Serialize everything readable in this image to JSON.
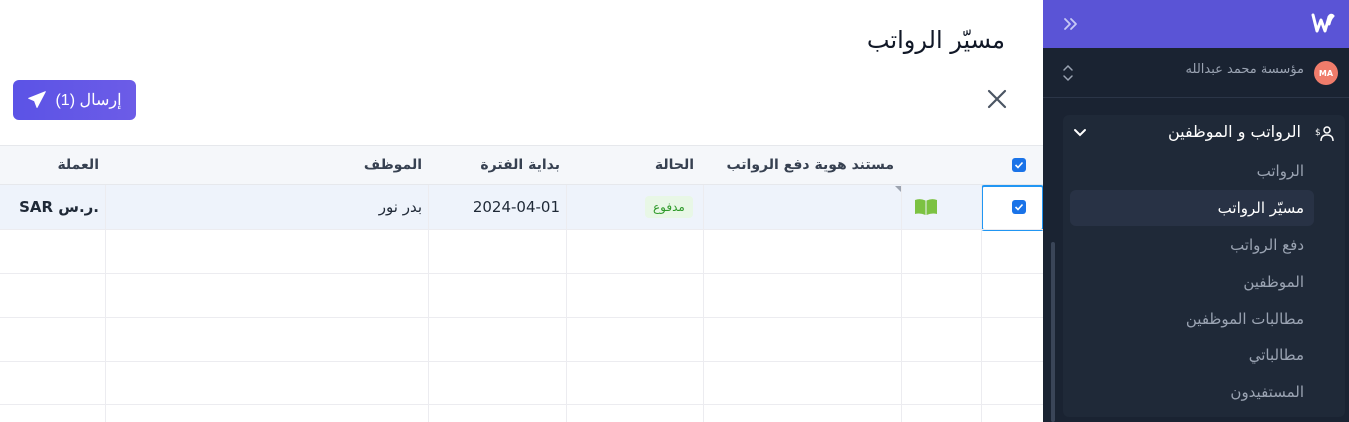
{
  "page": {
    "title": "مسيّر الرواتب",
    "send_button_label": "إرسال (1)"
  },
  "table": {
    "columns": [
      "مستند هوية دفع الرواتب",
      "الحالة",
      "بداية الفترة",
      "الموظف",
      "العملة"
    ],
    "rows": [
      {
        "selected": true,
        "document_id": "",
        "status": "مدفوع",
        "period_start": "2024-04-01",
        "employee": "بدر نور",
        "currency": "SAR ر.س."
      }
    ]
  },
  "sidebar": {
    "organization": {
      "avatar_initials": "MA",
      "name": "مؤسسة محمد عبدالله"
    },
    "group": {
      "label": "الرواتب و الموظفين",
      "items": [
        {
          "label": "الرواتب",
          "active": false
        },
        {
          "label": "مسيّر الرواتب",
          "active": true
        },
        {
          "label": "دفع الرواتب",
          "active": false
        },
        {
          "label": "الموظفين",
          "active": false
        },
        {
          "label": "مطالبات الموظفين",
          "active": false
        },
        {
          "label": "مطالباتي",
          "active": false
        },
        {
          "label": "المستفيدون",
          "active": false
        }
      ]
    }
  },
  "colors": {
    "accent": "#5a54d6",
    "primary_button": "#5b53e6",
    "checkbox": "#1a73e8",
    "status_paid_text": "#2e9a2a",
    "status_paid_bg": "#e8f7e6",
    "sidebar_bg": "#1a2332"
  },
  "icons": {
    "close": "close-icon",
    "send": "paper-plane-icon",
    "document": "open-book-icon",
    "collapse": "double-chevron-right-icon",
    "logo": "w-logo-icon",
    "switch": "up-down-chevron-icon",
    "group": "payroll-people-icon",
    "expand": "chevron-down-icon"
  }
}
